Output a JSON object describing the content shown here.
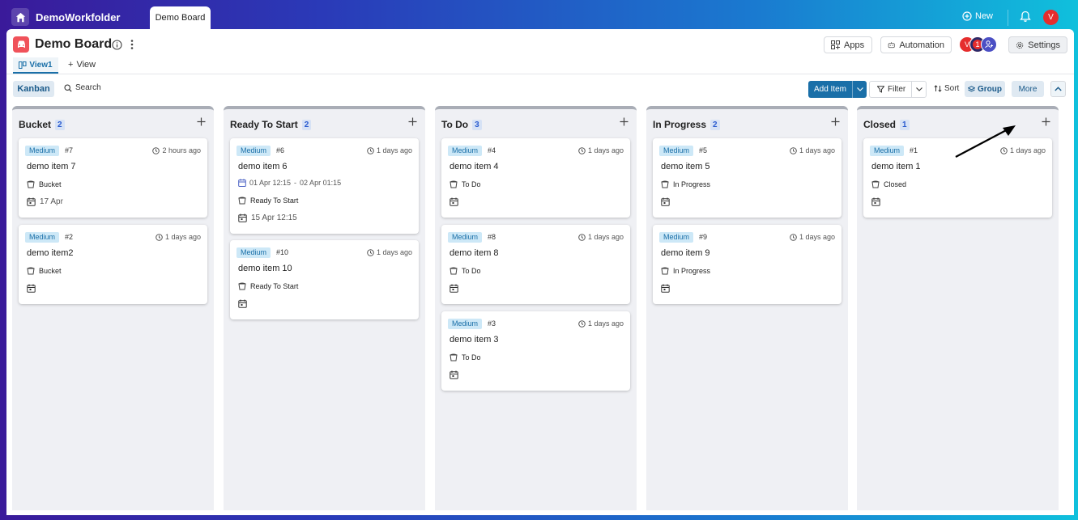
{
  "topbar": {
    "workspace": "DemoWorkfolder",
    "active_tab": "Demo Board",
    "new_label": "New",
    "user_initial": "V"
  },
  "board": {
    "title": "Demo Board",
    "apps_label": "Apps",
    "automation_label": "Automation",
    "settings_label": "Settings",
    "members": [
      "V",
      "1"
    ]
  },
  "views": {
    "active": "View1",
    "add_view": "View"
  },
  "toolbar": {
    "kanban": "Kanban",
    "search": "Search",
    "add_item": "Add Item",
    "filter": "Filter",
    "sort": "Sort",
    "group": "Group",
    "more": "More"
  },
  "columns": [
    {
      "title": "Bucket",
      "count": "2",
      "cards": [
        {
          "priority": "Medium",
          "id": "#7",
          "time": "2 hours ago",
          "name": "demo item 7",
          "status": "Bucket",
          "date": "17 Apr"
        },
        {
          "priority": "Medium",
          "id": "#2",
          "time": "1 days ago",
          "name": "demo item2",
          "status": "Bucket",
          "date": ""
        }
      ]
    },
    {
      "title": "Ready To Start",
      "count": "2",
      "cards": [
        {
          "priority": "Medium",
          "id": "#6",
          "time": "1 days ago",
          "name": "demo item 6",
          "range_start": "01 Apr 12:15",
          "range_sep": "-",
          "range_end": "02 Apr 01:15",
          "status": "Ready To Start",
          "date": "15 Apr 12:15"
        },
        {
          "priority": "Medium",
          "id": "#10",
          "time": "1 days ago",
          "name": "demo item 10",
          "status": "Ready To Start",
          "date": ""
        }
      ]
    },
    {
      "title": "To Do",
      "count": "3",
      "cards": [
        {
          "priority": "Medium",
          "id": "#4",
          "time": "1 days ago",
          "name": "demo item 4",
          "status": "To Do",
          "date": ""
        },
        {
          "priority": "Medium",
          "id": "#8",
          "time": "1 days ago",
          "name": "demo item 8",
          "status": "To Do",
          "date": ""
        },
        {
          "priority": "Medium",
          "id": "#3",
          "time": "1 days ago",
          "name": "demo item 3",
          "status": "To Do",
          "date": ""
        }
      ]
    },
    {
      "title": "In Progress",
      "count": "2",
      "cards": [
        {
          "priority": "Medium",
          "id": "#5",
          "time": "1 days ago",
          "name": "demo item 5",
          "status": "In Progress",
          "date": ""
        },
        {
          "priority": "Medium",
          "id": "#9",
          "time": "1 days ago",
          "name": "demo item 9",
          "status": "In Progress",
          "date": ""
        }
      ]
    },
    {
      "title": "Closed",
      "count": "1",
      "cards": [
        {
          "priority": "Medium",
          "id": "#1",
          "time": "1 days ago",
          "name": "demo item 1",
          "status": "Closed",
          "date": ""
        }
      ]
    }
  ],
  "colors": {
    "accent": "#1a6fa8",
    "board_icon": "#f0525a",
    "avatar_red": "#e52d2d",
    "avatar_purple": "#4b4fc4"
  }
}
